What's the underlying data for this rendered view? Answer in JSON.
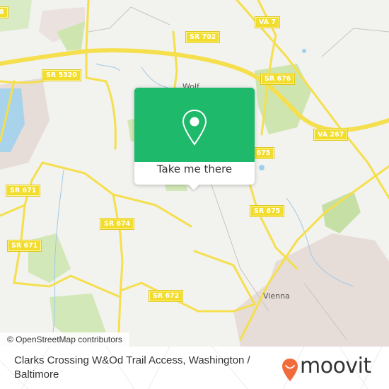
{
  "map": {
    "road_labels": [
      {
        "id": "sr-5320",
        "text": "SR 5320"
      },
      {
        "id": "sr-702",
        "text": "SR 702"
      },
      {
        "id": "va-7",
        "text": "VA 7"
      },
      {
        "id": "sr-676",
        "text": "SR 676"
      },
      {
        "id": "va-267",
        "text": "VA 267"
      },
      {
        "id": "sr-675-upper",
        "text": "SR 675"
      },
      {
        "id": "sr-675",
        "text": "SR 675"
      },
      {
        "id": "sr-671-upper",
        "text": "SR 671"
      },
      {
        "id": "sr-671-lower",
        "text": "SR 671"
      },
      {
        "id": "sr-674",
        "text": "SR 674"
      },
      {
        "id": "sr-672",
        "text": "SR 672"
      },
      {
        "id": "edge-shield",
        "text": "8"
      }
    ],
    "place_labels": [
      {
        "id": "vienna",
        "text": "Vienna"
      },
      {
        "id": "wolf-trap",
        "text": "Wolf"
      }
    ],
    "colors": {
      "land": "#f2f2ef",
      "road": "#f5df4d",
      "park": "#cfe5b0",
      "water": "#9fd0ea",
      "urban": "#e6dcd8",
      "popup_green": "#1eb96a",
      "moovit_orange": "#f26b3a"
    }
  },
  "popup": {
    "icon": "map-pin-icon",
    "button_label": "Take me there"
  },
  "attribution": "© OpenStreetMap contributors",
  "footer": {
    "title": "Clarks Crossing W&Od Trail Access, Washington / Baltimore",
    "logo_text": "moovit",
    "logo_icon": "moovit-smile-pin-icon"
  }
}
